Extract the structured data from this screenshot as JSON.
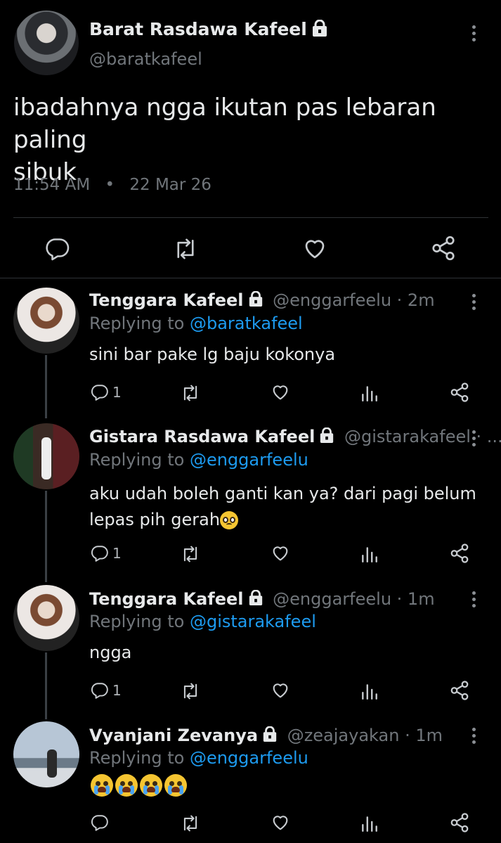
{
  "main_tweet": {
    "name": "Barat Rasdawa Kafeel",
    "handle": "@baratkafeel",
    "text_line1": "ibadahnya ngga ikutan pas lebaran paling",
    "text_line2": "sibuk",
    "time": "11:54 AM",
    "sep": "•",
    "date": "22 Mar 26"
  },
  "replies": [
    {
      "name": "Tenggara Kafeel",
      "handle_time": "@enggarfeelu · 2m",
      "replying_prefix": "Replying to",
      "replying_to": "@baratkafeel",
      "text": "sini bar pake lg baju kokonya",
      "reply_count": "1"
    },
    {
      "name": "Gistara Rasdawa Kafeel",
      "handle_time": "@gistarakafeel · ...",
      "replying_prefix": "Replying to",
      "replying_to": "@enggarfeelu",
      "text_line1": "aku udah boleh ganti kan ya? dari pagi belum",
      "text_line2": "lepas pih gerah",
      "reply_count": "1"
    },
    {
      "name": "Tenggara Kafeel",
      "handle_time": "@enggarfeelu · 1m",
      "replying_prefix": "Replying to",
      "replying_to": "@gistarakafeel",
      "text": "ngga",
      "reply_count": "1"
    },
    {
      "name": "Vyanjani Zevanya",
      "handle_time": "@zeajayakan · 1m",
      "replying_prefix": "Replying to",
      "replying_to": "@enggarfeelu",
      "reply_count": ""
    }
  ],
  "icons": {
    "reply": "reply-icon",
    "retweet": "retweet-icon",
    "like": "like-icon",
    "views": "views-icon",
    "share": "share-icon",
    "lock": "lock-icon",
    "more": "more-icon"
  },
  "colors": {
    "background": "#000000",
    "text": "#e7e9ea",
    "secondary": "#71767b",
    "link": "#1d9bf0"
  }
}
